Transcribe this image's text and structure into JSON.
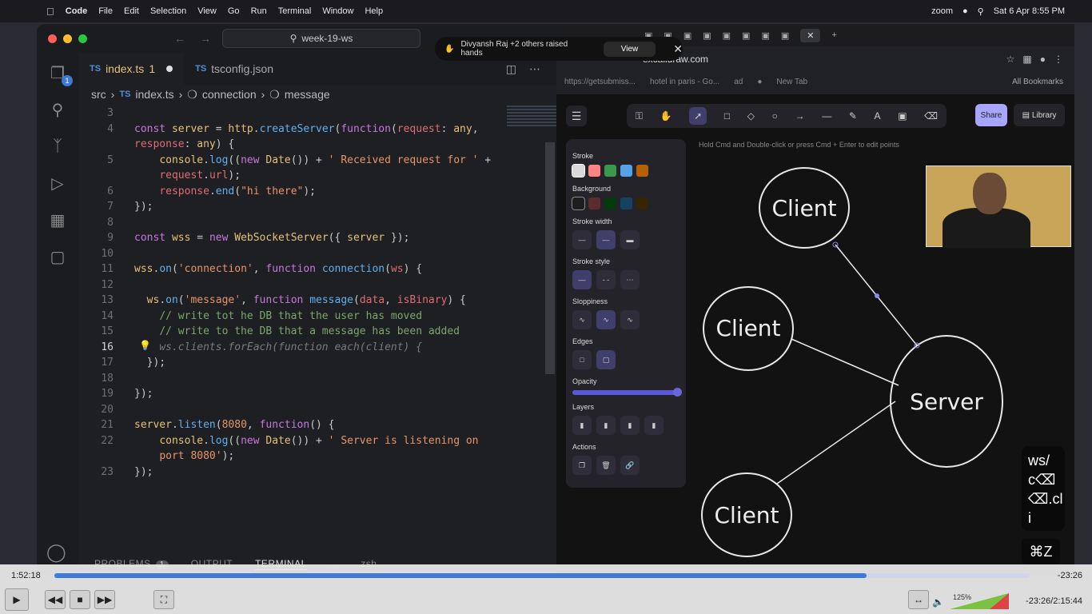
{
  "menubar": {
    "app": "Code",
    "items": [
      "File",
      "Edit",
      "Selection",
      "View",
      "Go",
      "Run",
      "Terminal",
      "Window",
      "Help"
    ],
    "zoom_label": "zoom",
    "datetime": "Sat 6 Apr  8:55 PM"
  },
  "vscode": {
    "search": "week-19-ws",
    "tabs": [
      {
        "name": "index.ts",
        "badge": "1"
      },
      {
        "name": "tsconfig.json"
      }
    ],
    "tab_prefix": "TS",
    "breadcrumb": [
      "src",
      "index.ts",
      "connection",
      "message"
    ],
    "explorer_badge": "1",
    "panel": {
      "problems": "PROBLEMS",
      "problems_count": "1",
      "output": "OUTPUT",
      "terminal": "TERMINAL",
      "more": "...",
      "shell": "zsh"
    }
  },
  "code": {
    "current_line": "16",
    "lines": [
      {
        "n": "3",
        "text": ""
      },
      {
        "n": "4",
        "html": "<span class='k'>const</span> <span class='y'>server</span> = <span class='t'>http</span>.<span class='f'>createServer</span>(<span class='k'>function</span>(<span class='p'>request</span>: <span class='t'>any</span>,"
      },
      {
        "n": "",
        "html": "<span class='p'>response</span>: <span class='t'>any</span>) {"
      },
      {
        "n": "5",
        "html": "    <span class='t'>console</span>.<span class='f'>log</span>((<span class='k'>new</span> <span class='t'>Date</span>()) + <span class='s'>' Received request for '</span> +"
      },
      {
        "n": "",
        "html": "    <span class='p'>request</span>.<span class='p'>url</span>);"
      },
      {
        "n": "6",
        "html": "    <span class='p'>response</span>.<span class='f'>end</span>(<span class='s'>\"hi there\"</span>);"
      },
      {
        "n": "7",
        "html": "});"
      },
      {
        "n": "8",
        "text": ""
      },
      {
        "n": "9",
        "html": "<span class='k'>const</span> <span class='y'>wss</span> = <span class='k'>new</span> <span class='t'>WebSocketServer</span>({ <span class='y'>server</span> });"
      },
      {
        "n": "10",
        "text": ""
      },
      {
        "n": "11",
        "html": "<span class='y'>wss</span>.<span class='f'>on</span>(<span class='s'>'connection'</span>, <span class='k'>function</span> <span class='f'>connection</span>(<span class='p'>ws</span>) {"
      },
      {
        "n": "12",
        "text": ""
      },
      {
        "n": "13",
        "html": "  <span class='y'>ws</span>.<span class='f'>on</span>(<span class='s'>'message'</span>, <span class='k'>function</span> <span class='f'>message</span>(<span class='p'>data</span>, <span class='p'>isBinary</span>) {"
      },
      {
        "n": "14",
        "html": "    <span class='c'>// write tot he DB that the user has moved</span>"
      },
      {
        "n": "15",
        "html": "    <span class='c'>// write to the DB that a message has been added</span>"
      },
      {
        "n": "16",
        "html": "    <span class='g'>ws.clients.forEach(function each(client) {</span>"
      },
      {
        "n": "17",
        "html": "  });"
      },
      {
        "n": "18",
        "text": ""
      },
      {
        "n": "19",
        "html": "});"
      },
      {
        "n": "20",
        "text": ""
      },
      {
        "n": "21",
        "html": "<span class='y'>server</span>.<span class='f'>listen</span>(<span class='s'>8080</span>, <span class='k'>function</span>() {"
      },
      {
        "n": "22",
        "html": "    <span class='t'>console</span>.<span class='f'>log</span>((<span class='k'>new</span> <span class='t'>Date</span>()) + <span class='s'>' Server is listening on</span>"
      },
      {
        "n": "",
        "html": "    <span class='s'>port 8080'</span>);"
      },
      {
        "n": "23",
        "html": "});"
      }
    ]
  },
  "zoom_notice": {
    "text": "Divyansh Raj +2 others raised hands",
    "view": "View"
  },
  "browser": {
    "url": "excalidraw.com",
    "bookmarks": [
      "https://getsubmiss...",
      "hotel in paris - Go...",
      "ad",
      "",
      "New Tab"
    ],
    "all_bookmarks": "All Bookmarks"
  },
  "excalidraw": {
    "hint": "Hold Cmd and Double-click or press Cmd + Enter to edit points",
    "share": "Share",
    "library": "Library",
    "props": {
      "stroke": "Stroke",
      "background": "Background",
      "stroke_width": "Stroke width",
      "stroke_style": "Stroke style",
      "sloppiness": "Sloppiness",
      "edges": "Edges",
      "opacity": "Opacity",
      "layers": "Layers",
      "actions": "Actions"
    },
    "stroke_colors": [
      "#d9d9d9",
      "#ff8383",
      "#3a994c",
      "#56a2e8",
      "#b76100"
    ],
    "bg_colors": [
      "#1e1e1e",
      "#5b2c2c",
      "#043b0c",
      "#154163",
      "#362600"
    ],
    "diagram": {
      "client_1": "Client",
      "client_2": "Client",
      "client_3": "Client",
      "server": "Server"
    },
    "keycast": "ws/\nc⌫\n⌫.cl\ni",
    "keycast2": "⌘Z"
  },
  "video": {
    "current": "1:52:18",
    "remaining": "-23:26",
    "progress": 0.833,
    "volume": "125%",
    "elapsed": "-23:26/2:15:44"
  }
}
